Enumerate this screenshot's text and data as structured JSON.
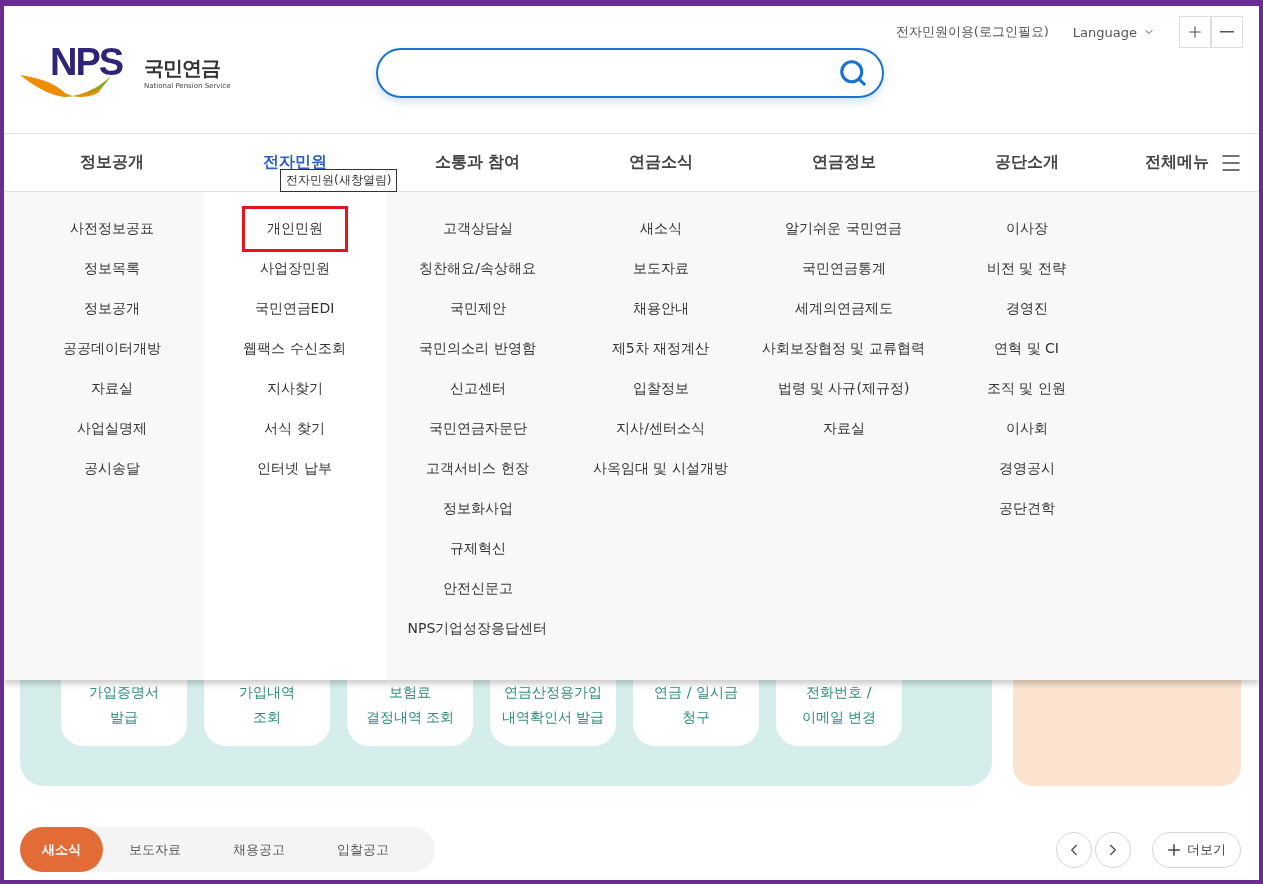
{
  "header": {
    "logo": {
      "mark": "NPS",
      "name": "국민연금",
      "subtitle": "National Pension Service"
    },
    "login_link": "전자민원이용(로그인필요)",
    "language": "Language"
  },
  "nav": [
    {
      "label": "정보공개",
      "selected": false
    },
    {
      "label": "전자민원",
      "selected": true
    },
    {
      "label": "소통과 참여",
      "selected": false
    },
    {
      "label": "연금소식",
      "selected": false
    },
    {
      "label": "연금정보",
      "selected": false
    },
    {
      "label": "공단소개",
      "selected": false
    }
  ],
  "all_menu": "전체메뉴",
  "tooltip": "전자민원(새창열림)",
  "mega_menu": [
    {
      "items": [
        {
          "label": "사전정보공표",
          "highlighted": false
        },
        {
          "label": "정보목록",
          "highlighted": false
        },
        {
          "label": "정보공개",
          "highlighted": false
        },
        {
          "label": "공공데이터개방",
          "highlighted": false
        },
        {
          "label": "자료실",
          "highlighted": false
        },
        {
          "label": "사업실명제",
          "highlighted": false
        },
        {
          "label": "공시송달",
          "highlighted": false
        }
      ]
    },
    {
      "items": [
        {
          "label": "개인민원",
          "highlighted": true
        },
        {
          "label": "사업장민원",
          "highlighted": false
        },
        {
          "label": "국민연금EDI",
          "highlighted": false
        },
        {
          "label": "웹팩스 수신조회",
          "highlighted": false
        },
        {
          "label": "지사찾기",
          "highlighted": false
        },
        {
          "label": "서식 찾기",
          "highlighted": false
        },
        {
          "label": "인터넷 납부",
          "highlighted": false
        }
      ]
    },
    {
      "items": [
        {
          "label": "고객상담실",
          "highlighted": false
        },
        {
          "label": "칭찬해요/속상해요",
          "highlighted": false
        },
        {
          "label": "국민제안",
          "highlighted": false
        },
        {
          "label": "국민의소리 반영함",
          "highlighted": false
        },
        {
          "label": "신고센터",
          "highlighted": false
        },
        {
          "label": "국민연금자문단",
          "highlighted": false
        },
        {
          "label": "고객서비스 헌장",
          "highlighted": false
        },
        {
          "label": "정보화사업",
          "highlighted": false
        },
        {
          "label": "규제혁신",
          "highlighted": false
        },
        {
          "label": "안전신문고",
          "highlighted": false
        },
        {
          "label": "NPS기업성장응답센터",
          "highlighted": false
        }
      ]
    },
    {
      "items": [
        {
          "label": "새소식",
          "highlighted": false
        },
        {
          "label": "보도자료",
          "highlighted": false
        },
        {
          "label": "채용안내",
          "highlighted": false
        },
        {
          "label": "제5차 재정계산",
          "highlighted": false
        },
        {
          "label": "입찰정보",
          "highlighted": false
        },
        {
          "label": "지사/센터소식",
          "highlighted": false
        },
        {
          "label": "사옥임대 및 시설개방",
          "highlighted": false
        }
      ]
    },
    {
      "items": [
        {
          "label": "알기쉬운 국민연금",
          "highlighted": false
        },
        {
          "label": "국민연금통계",
          "highlighted": false
        },
        {
          "label": "세계의연금제도",
          "highlighted": false
        },
        {
          "label": "사회보장협정 및 교류협력",
          "highlighted": false
        },
        {
          "label": "법령 및 사규(제규정)",
          "highlighted": false
        },
        {
          "label": "자료실",
          "highlighted": false
        }
      ]
    },
    {
      "items": [
        {
          "label": "이사장",
          "highlighted": false
        },
        {
          "label": "비전 및 전략",
          "highlighted": false
        },
        {
          "label": "경영진",
          "highlighted": false
        },
        {
          "label": "연혁 및 CI",
          "highlighted": false
        },
        {
          "label": "조직 및 인원",
          "highlighted": false
        },
        {
          "label": "이사회",
          "highlighted": false
        },
        {
          "label": "경영공시",
          "highlighted": false
        },
        {
          "label": "공단견학",
          "highlighted": false
        }
      ]
    }
  ],
  "quick_services": [
    "가입증명서\n발급",
    "가입내역\n조회",
    "보험료\n결정내역 조회",
    "연금산정용가입\n내역확인서 발급",
    "연금 / 일시금\n청구",
    "전화번호 /\n이메일 변경"
  ],
  "news_tabs": [
    {
      "label": "새소식",
      "selected": true
    },
    {
      "label": "보도자료",
      "selected": false
    },
    {
      "label": "채용공고",
      "selected": false
    },
    {
      "label": "입찰공고",
      "selected": false
    }
  ],
  "more_button": "더보기"
}
